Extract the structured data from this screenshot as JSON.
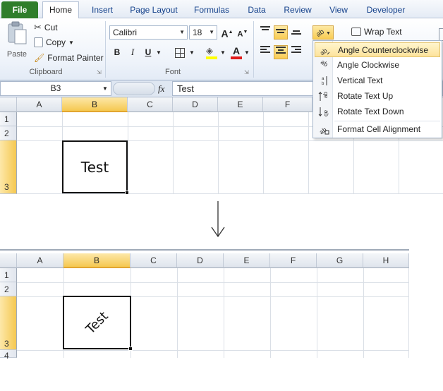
{
  "tabs": [
    "File",
    "Home",
    "Insert",
    "Page Layout",
    "Formulas",
    "Data",
    "Review",
    "View",
    "Developer"
  ],
  "clipboard": {
    "paste": "Paste",
    "cut": "Cut",
    "copy": "Copy",
    "format_painter": "Format Painter",
    "group_label": "Clipboard"
  },
  "font": {
    "name": "Calibri",
    "size": "18",
    "bold": "B",
    "italic": "I",
    "underline": "U",
    "font_color_letter": "A",
    "grow": "A",
    "shrink": "A",
    "group_label": "Font"
  },
  "alignment": {
    "wrap_text": "Wrap Text"
  },
  "orientation_menu": {
    "items": [
      "Angle Counterclockwise",
      "Angle Clockwise",
      "Vertical Text",
      "Rotate Text Up",
      "Rotate Text Down",
      "Format Cell Alignment"
    ]
  },
  "formula_bar": {
    "name_box": "B3",
    "fx": "fx",
    "value": "Test"
  },
  "sheet_top": {
    "columns": [
      "A",
      "B",
      "C",
      "D",
      "E",
      "F"
    ],
    "rows": [
      "1",
      "2",
      "3"
    ],
    "cell_text": "Test"
  },
  "sheet_bottom": {
    "columns": [
      "A",
      "B",
      "C",
      "D",
      "E",
      "F",
      "G",
      "H"
    ],
    "rows": [
      "1",
      "2",
      "3",
      "4"
    ],
    "cell_text": "Test"
  },
  "colors": {
    "file_tab": "#2f7e2b",
    "selection_header": "#f5c851",
    "menu_hover": "#fde39c"
  }
}
